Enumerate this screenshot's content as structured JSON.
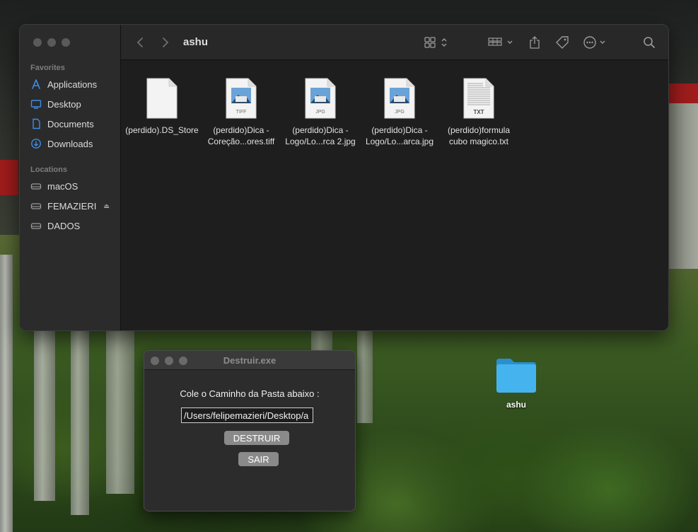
{
  "finder": {
    "title": "ashu",
    "sidebar": {
      "favorites_header": "Favorites",
      "favorites": [
        {
          "label": "Applications",
          "icon": "applications-icon"
        },
        {
          "label": "Desktop",
          "icon": "desktop-icon"
        },
        {
          "label": "Documents",
          "icon": "document-icon"
        },
        {
          "label": "Downloads",
          "icon": "downloads-icon"
        }
      ],
      "locations_header": "Locations",
      "locations": [
        {
          "label": "macOS",
          "icon": "drive-icon"
        },
        {
          "label": "FEMAZIERI",
          "icon": "drive-icon",
          "ejectable": true
        },
        {
          "label": "DADOS",
          "icon": "drive-icon"
        }
      ]
    },
    "files": [
      {
        "label": "(perdido).DS_Store",
        "kind": "blank"
      },
      {
        "label": "(perdido)Dica - Coreção...ores.tiff",
        "kind": "image",
        "badge": "TIFF"
      },
      {
        "label": "(perdido)Dica - Logo/Lo...rca 2.jpg",
        "kind": "image",
        "badge": "JPG"
      },
      {
        "label": "(perdido)Dica - Logo/Lo...arca.jpg",
        "kind": "image",
        "badge": "JPG"
      },
      {
        "label": "(perdido)formula cubo magico.txt",
        "kind": "text",
        "badge": "TXT"
      }
    ]
  },
  "dialog": {
    "title": "Destruir.exe",
    "prompt": "Cole o Caminho da Pasta abaixo :",
    "path_value": "/Users/felipemazieri/Desktop/a",
    "destroy_label": "DESTRUIR",
    "exit_label": "SAIR"
  },
  "desktop": {
    "folder_label": "ashu"
  },
  "colors": {
    "folder_blue": "#3fb0ea",
    "window_bg": "#1e1e1e",
    "sidebar_bg": "#2b2b2b"
  }
}
